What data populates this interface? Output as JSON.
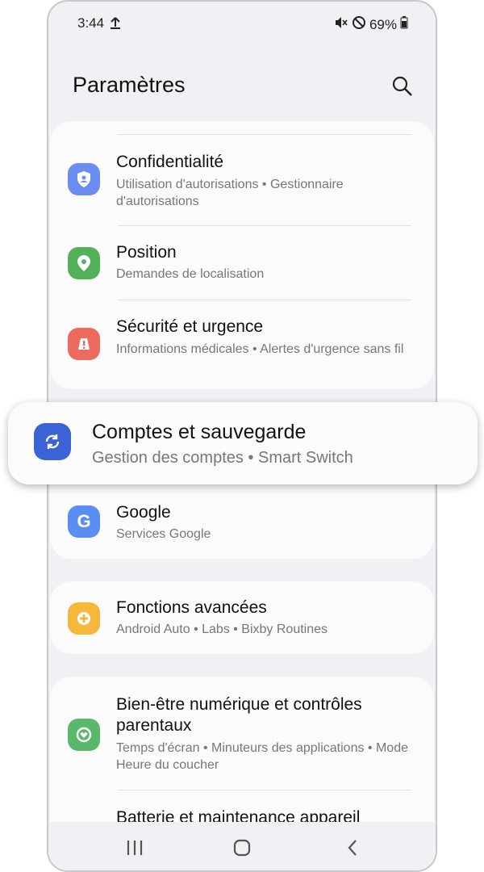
{
  "status": {
    "time": "3:44",
    "battery": "69%"
  },
  "header": {
    "title": "Paramètres"
  },
  "rows": {
    "privacy": {
      "title": "Confidentialité",
      "subtitle": "Utilisation d'autorisations  •  Gestionnaire d'autorisations"
    },
    "location": {
      "title": "Position",
      "subtitle": "Demandes de localisation"
    },
    "safety": {
      "title": "Sécurité et urgence",
      "subtitle": "Informations médicales  •  Alertes d'urgence sans fil"
    },
    "accounts": {
      "title": "Comptes et sauvegarde",
      "subtitle": "Gestion des comptes  •  Smart Switch"
    },
    "google": {
      "title": "Google",
      "subtitle": "Services Google"
    },
    "advanced": {
      "title": "Fonctions avancées",
      "subtitle": "Android Auto  •  Labs  •  Bixby Routines"
    },
    "wellbeing": {
      "title": "Bien-être numérique et contrôles parentaux",
      "subtitle": "Temps d'écran  •  Minuteurs des applications  •  Mode Heure du coucher"
    },
    "battery": {
      "title": "Batterie et maintenance appareil"
    }
  },
  "colors": {
    "privacy": "#6b8cf0",
    "location": "#55b05a",
    "safety": "#ec6a5e",
    "accounts": "#3b63d6",
    "google": "#5a8ef2",
    "advanced": "#f5b83a",
    "wellbeing": "#59b86a",
    "battery": "#2aa99b"
  }
}
